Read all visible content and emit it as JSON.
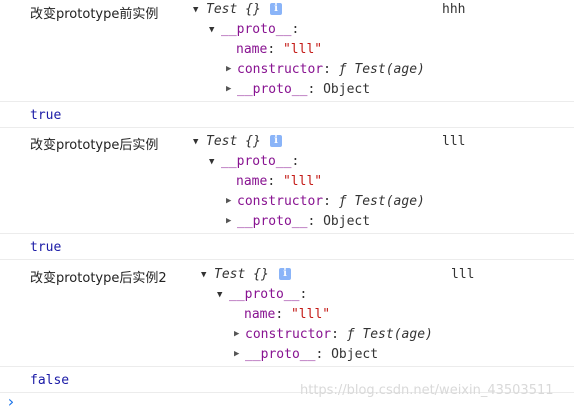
{
  "entries": [
    {
      "label": "改变prototype前实例",
      "object_preview": "Test {}",
      "proto_key": "__proto__",
      "name_key": "name",
      "name_value": "\"lll\"",
      "constructor_key": "constructor",
      "constructor_value": "ƒ Test(age)",
      "inner_proto_key": "__proto__",
      "inner_proto_value": "Object",
      "logged_value": "hhh",
      "result": "true"
    },
    {
      "label": "改变prototype后实例",
      "object_preview": "Test {}",
      "proto_key": "__proto__",
      "name_key": "name",
      "name_value": "\"lll\"",
      "constructor_key": "constructor",
      "constructor_value": "ƒ Test(age)",
      "inner_proto_key": "__proto__",
      "inner_proto_value": "Object",
      "logged_value": "lll",
      "result": "true"
    },
    {
      "label": "改变prototype后实例2",
      "object_preview": "Test {}",
      "proto_key": "__proto__",
      "name_key": "name",
      "name_value": "\"lll\"",
      "constructor_key": "constructor",
      "constructor_value": "ƒ Test(age)",
      "inner_proto_key": "__proto__",
      "inner_proto_value": "Object",
      "logged_value": "lll",
      "result": "false"
    }
  ],
  "info_badge": "i",
  "prompt_symbol": "›",
  "watermark": "https://blog.csdn.net/weixin_43503511",
  "colors": {
    "key": "#881391",
    "string": "#c41a16",
    "boolean": "#1a1aa6",
    "info_badge": "#8ab4f8",
    "prompt": "#1a73e8"
  }
}
